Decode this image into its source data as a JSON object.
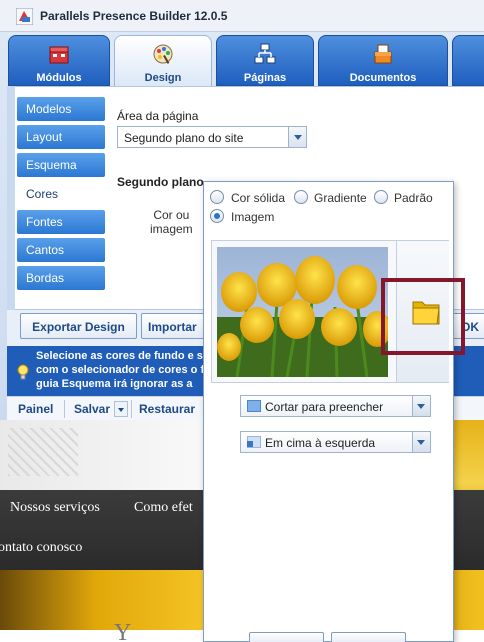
{
  "app": {
    "title": "Parallels Presence Builder 12.0.5"
  },
  "tabs": [
    {
      "label": "Módulos",
      "icon": "modules-icon"
    },
    {
      "label": "Design",
      "icon": "palette-icon"
    },
    {
      "label": "Páginas",
      "icon": "sitemap-icon"
    },
    {
      "label": "Documentos",
      "icon": "documents-icon"
    },
    {
      "label": ""
    }
  ],
  "subnav": [
    {
      "label": "Modelos"
    },
    {
      "label": "Layout"
    },
    {
      "label": "Esquema"
    },
    {
      "label": "Cores"
    },
    {
      "label": "Fontes"
    },
    {
      "label": "Cantos"
    },
    {
      "label": "Bordas"
    }
  ],
  "design": {
    "area_label": "Área da página",
    "area_value": "Segundo plano do site",
    "section_title": "Segundo plano",
    "color_label": "Cor ou\nimagem"
  },
  "buttons": {
    "export": "Exportar Design",
    "import": "Importar",
    "ok": "OK"
  },
  "tip": {
    "text": "Selecione as cores de fundo e                                                                      site\ncom o selecionador de cores o                                                                 ficaç\nguia Esquema irá ignorar as a"
  },
  "bottom_bar": {
    "panel": "Painel",
    "save": "Salvar",
    "restore": "Restaurar"
  },
  "popup": {
    "options": [
      {
        "label": "Cor sólida",
        "checked": false
      },
      {
        "label": "Gradiente",
        "checked": false
      },
      {
        "label": "Padrão",
        "checked": false
      },
      {
        "label": "Imagem",
        "checked": true
      }
    ],
    "fit_mode": "Cortar para preencher",
    "position": "Em cima à esquerda"
  },
  "website": {
    "menu": [
      "Nossos serviços",
      "Como efet",
      "ontato conosco"
    ],
    "footer_char": "Y"
  },
  "colors": {
    "tab_blue": "#2b6fcf",
    "tip_blue": "#1f5db8",
    "highlight": "#84172b"
  }
}
